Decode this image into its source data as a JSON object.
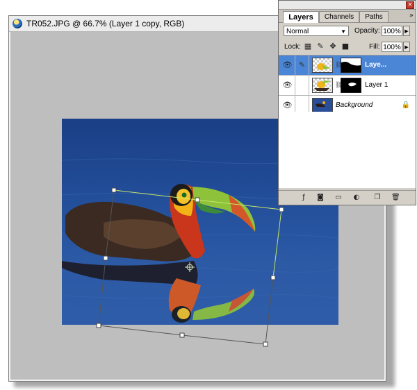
{
  "document": {
    "title": "TR052.JPG @ 66.7% (Layer 1 copy, RGB)",
    "canvas_color": "#bebebe"
  },
  "layers_panel": {
    "tabs": [
      {
        "label": "Layers",
        "active": true
      },
      {
        "label": "Channels",
        "active": false
      },
      {
        "label": "Paths",
        "active": false
      }
    ],
    "close_icon": "close-icon",
    "menu_icon": "panel-menu-icon",
    "blend_mode": "Normal",
    "opacity_label": "Opacity:",
    "opacity_value": "100%",
    "lock_label": "Lock:",
    "fill_label": "Fill:",
    "fill_value": "100%",
    "layers": [
      {
        "name": "Laye...",
        "selected": true,
        "has_mask": true,
        "visible": true,
        "link_icon": "brush-icon"
      },
      {
        "name": "Layer 1",
        "selected": false,
        "has_mask": true,
        "visible": true
      },
      {
        "name": "Background",
        "selected": false,
        "has_mask": false,
        "visible": true,
        "locked": true
      }
    ],
    "bottom_icons": [
      "layer-style-icon",
      "add-mask-icon",
      "new-set-icon",
      "adjustment-layer-icon",
      "new-layer-icon",
      "trash-icon"
    ]
  },
  "colors": {
    "selection_blue": "#4b86d6",
    "transform_outline": "#c8e86a"
  }
}
